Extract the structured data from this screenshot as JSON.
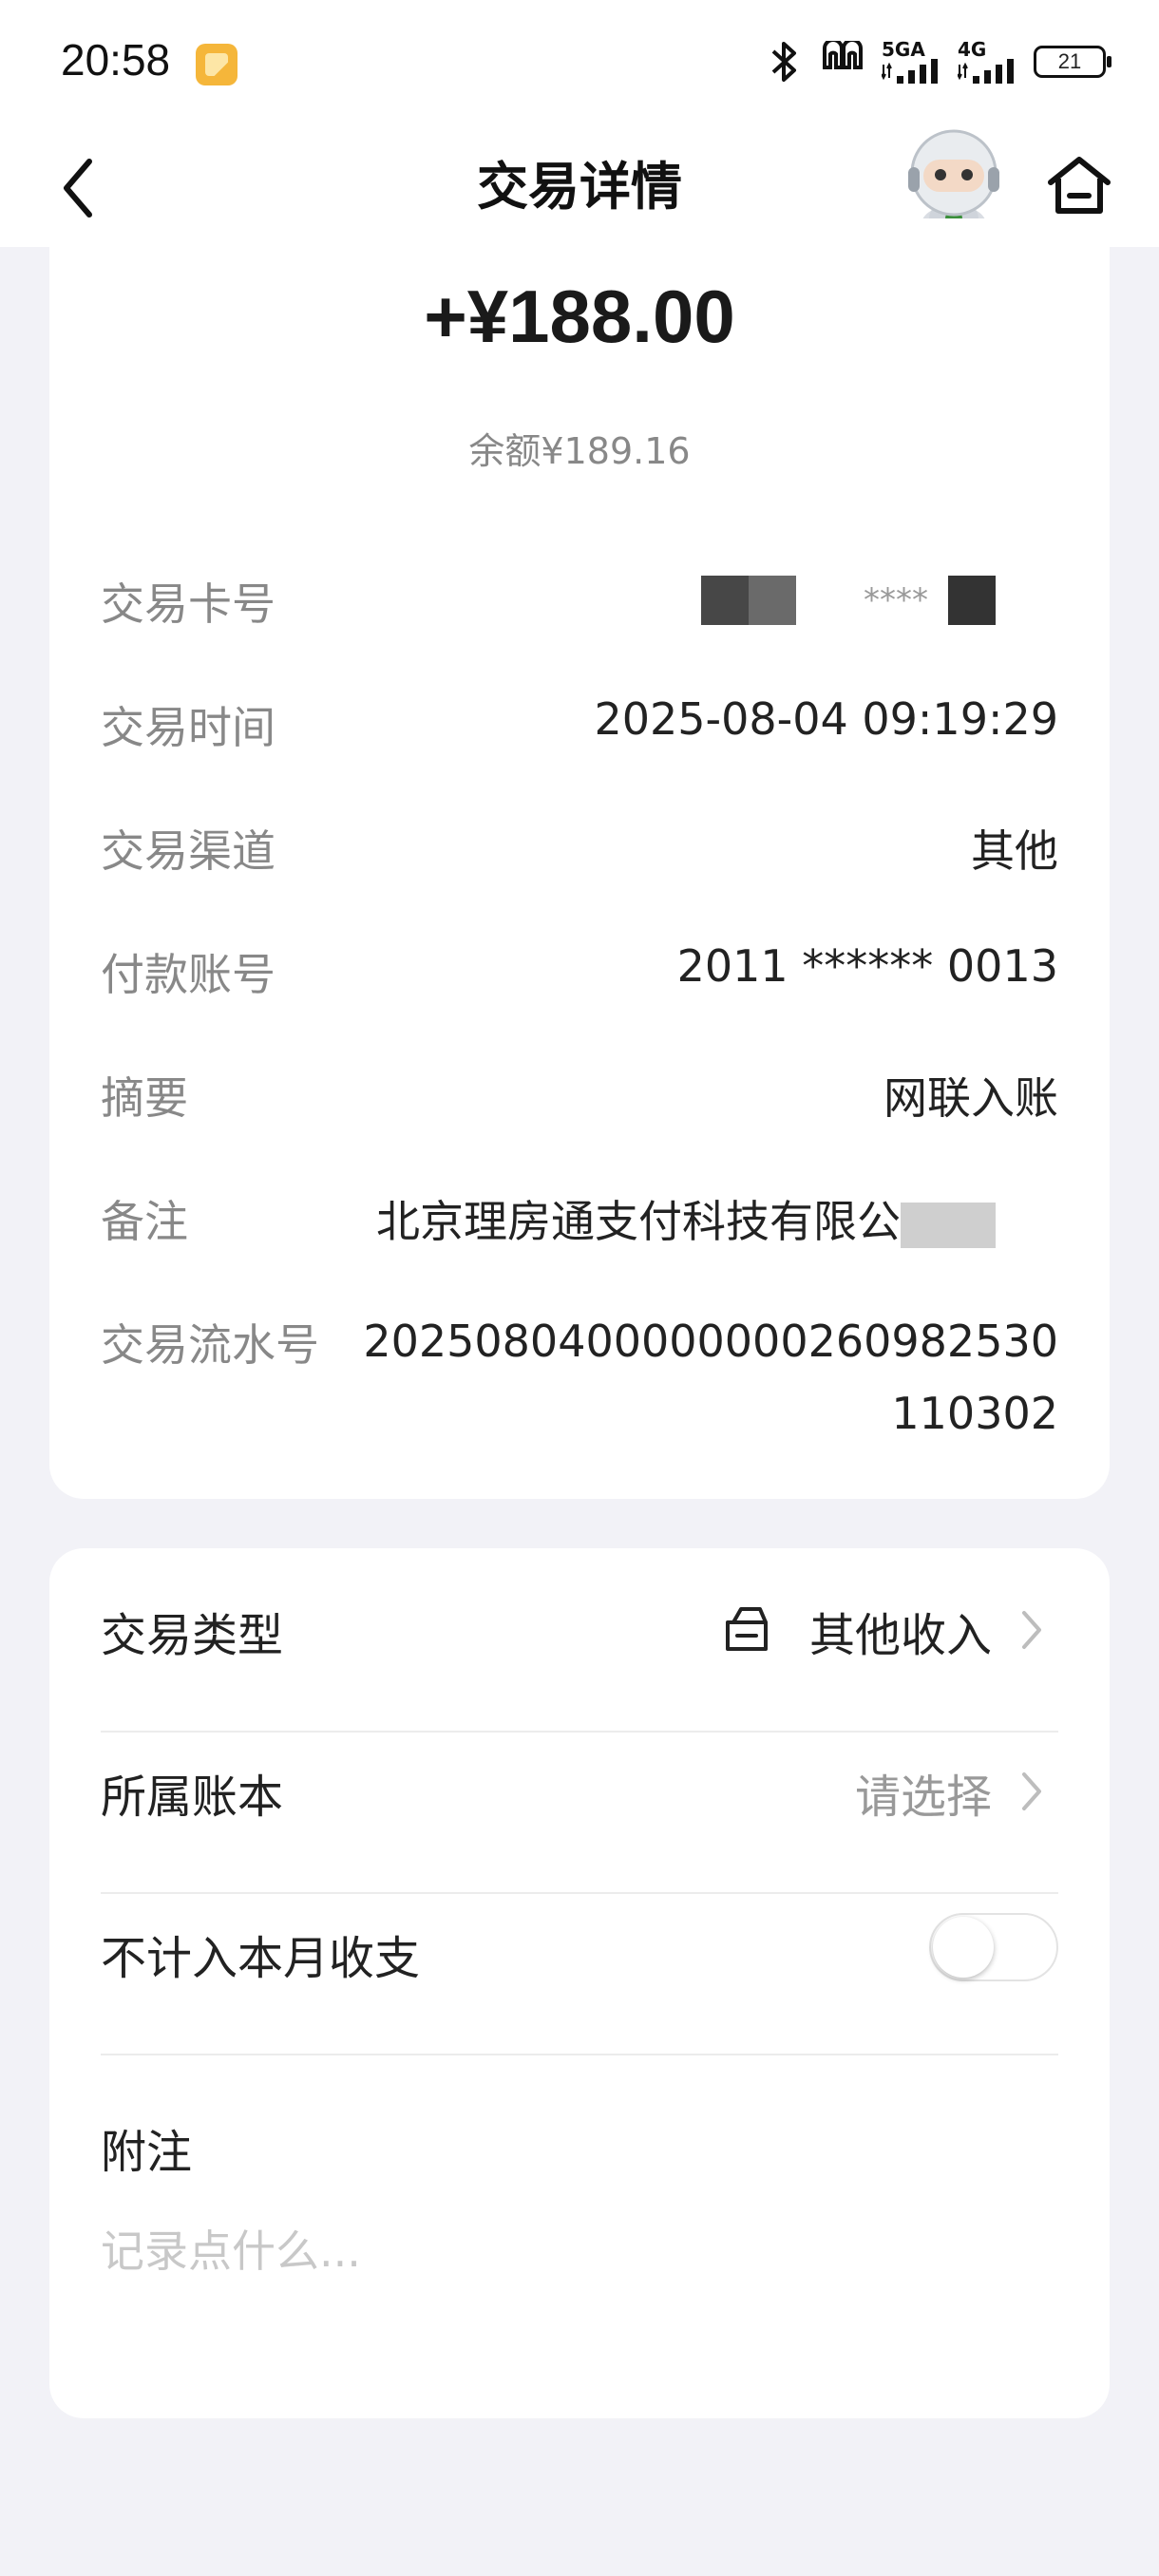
{
  "status_bar": {
    "time": "20:58",
    "network_1": "5GA",
    "network_2": "4G",
    "battery": "21"
  },
  "header": {
    "title": "交易详情"
  },
  "transaction": {
    "amount": "+¥188.00",
    "balance": "余额¥189.16",
    "card_number_label": "交易卡号",
    "card_number_visible": "****",
    "time_label": "交易时间",
    "time_value": "2025-08-04 09:19:29",
    "channel_label": "交易渠道",
    "channel_value": "其他",
    "payer_account_label": "付款账号",
    "payer_account_value": "2011 ****** 0013",
    "summary_label": "摘要",
    "summary_value": "网联入账",
    "remark_label": "备注",
    "remark_value": "北京理房通支付科技有限公",
    "serial_label": "交易流水号",
    "serial_value": "2025080400000000260982530110302"
  },
  "settings": {
    "type_label": "交易类型",
    "type_value": "其他收入",
    "ledger_label": "所属账本",
    "ledger_value": "请选择",
    "exclude_label": "不计入本月收支",
    "exclude_enabled": false,
    "note_label": "附注",
    "note_placeholder": "记录点什么..."
  }
}
